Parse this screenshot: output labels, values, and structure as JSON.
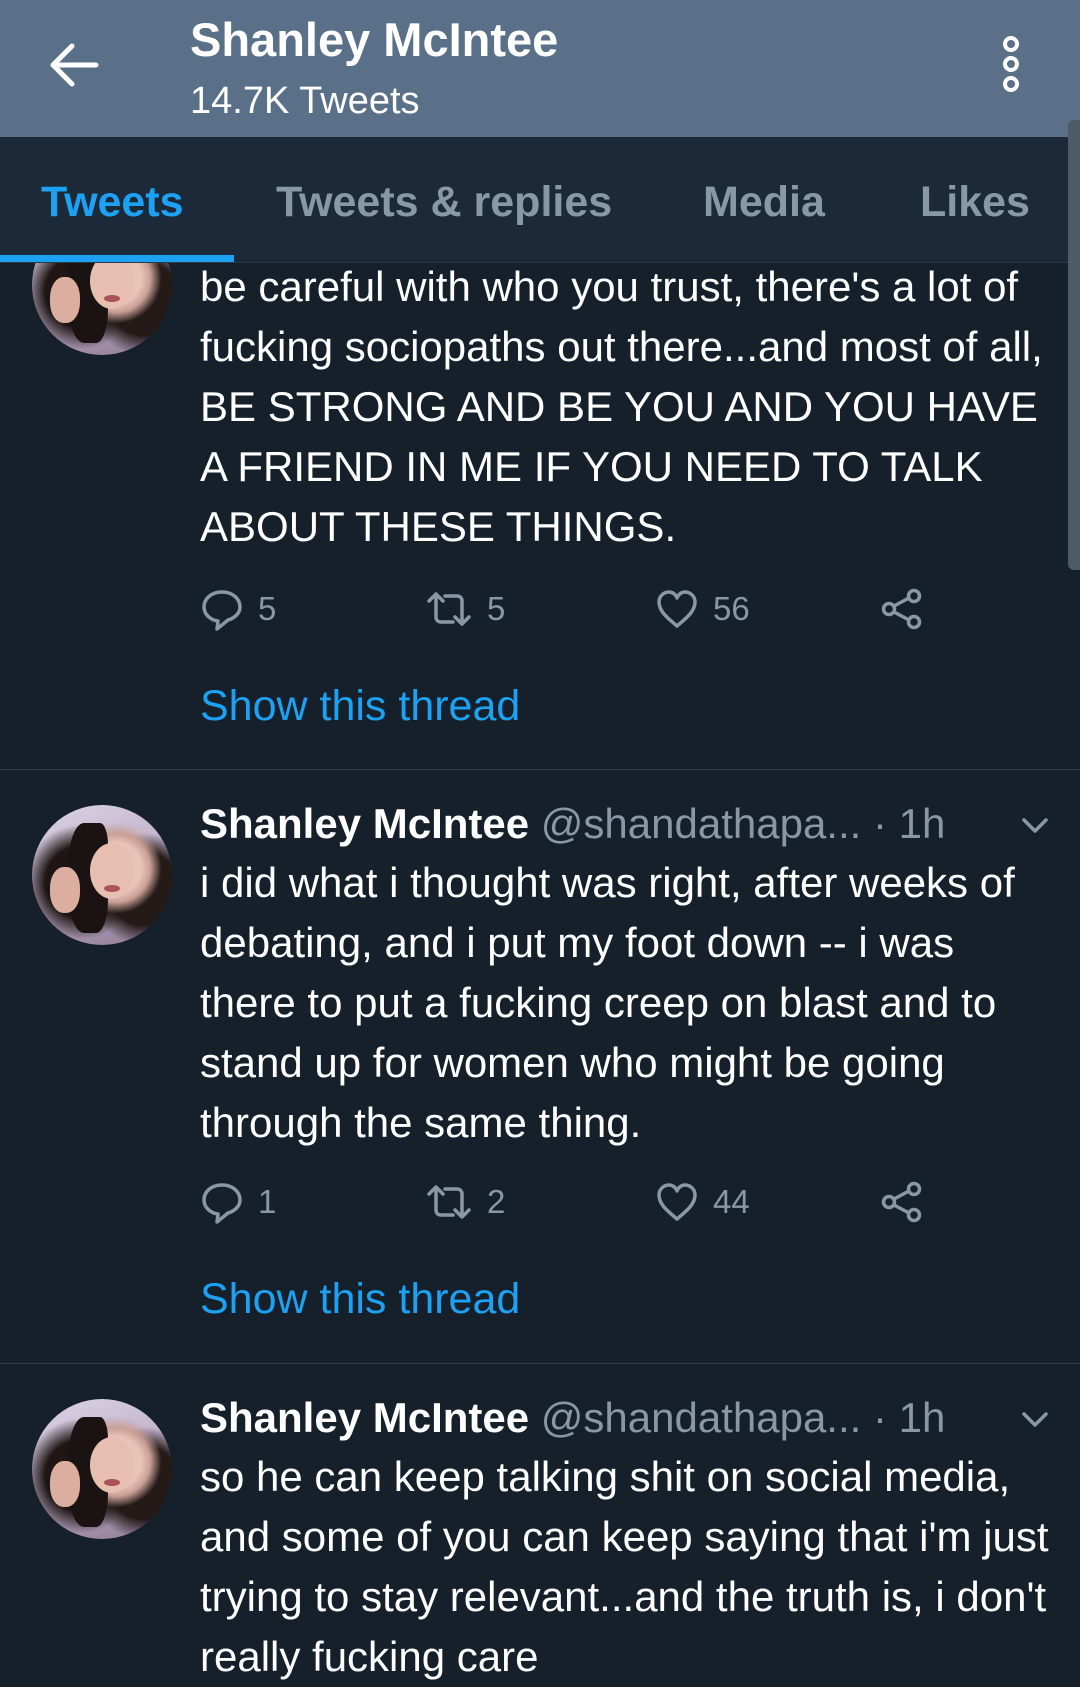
{
  "header": {
    "title": "Shanley McIntee",
    "subtitle": "14.7K Tweets"
  },
  "tabs": [
    {
      "label": "Tweets",
      "active": true
    },
    {
      "label": "Tweets & replies",
      "active": false
    },
    {
      "label": "Media",
      "active": false
    },
    {
      "label": "Likes",
      "active": false
    }
  ],
  "colors": {
    "background": "#15202b",
    "header": "#5a7089",
    "accent": "#1da1f2",
    "muted": "#8899a6"
  },
  "tweets": [
    {
      "text": "be careful with who you trust, there's a lot of fucking sociopaths out there...and most of all, BE STRONG AND BE YOU AND YOU HAVE A FRIEND IN ME IF YOU NEED TO TALK ABOUT THESE THINGS.",
      "replies": "5",
      "retweets": "5",
      "likes": "56",
      "show_thread": "Show this thread"
    },
    {
      "name": "Shanley McIntee",
      "handle": "@shandathapa...",
      "time": "· 1h",
      "text": "i did what i thought was right, after weeks of debating, and i put my foot down -- i was there to put a fucking creep on blast and to stand up for women who might be going through the same thing.",
      "replies": "1",
      "retweets": "2",
      "likes": "44",
      "show_thread": "Show this thread"
    },
    {
      "name": "Shanley McIntee",
      "handle": "@shandathapa...",
      "time": "· 1h",
      "text": "so he can keep talking shit on social media, and some of you can keep saying that i'm just trying to stay relevant...and the truth is, i don't really fucking care"
    }
  ]
}
